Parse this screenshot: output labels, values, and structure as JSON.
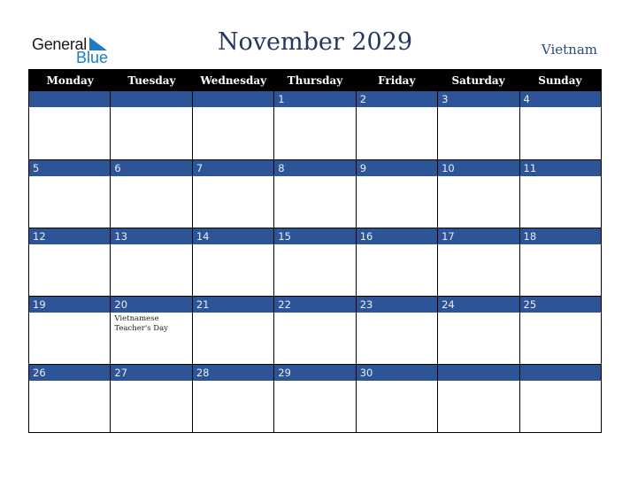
{
  "logo": {
    "word1": "General",
    "word2": "Blue"
  },
  "title": "November 2029",
  "country": "Vietnam",
  "colors": {
    "header_bg": "#000000",
    "date_bar": "#2d5496",
    "title": "#24375f",
    "logo_blue": "#1f7bc1"
  },
  "weekdays": [
    "Monday",
    "Tuesday",
    "Wednesday",
    "Thursday",
    "Friday",
    "Saturday",
    "Sunday"
  ],
  "weeks": [
    {
      "days": [
        {
          "date": "",
          "event": ""
        },
        {
          "date": "",
          "event": ""
        },
        {
          "date": "",
          "event": ""
        },
        {
          "date": "1",
          "event": ""
        },
        {
          "date": "2",
          "event": ""
        },
        {
          "date": "3",
          "event": ""
        },
        {
          "date": "4",
          "event": ""
        }
      ]
    },
    {
      "days": [
        {
          "date": "5",
          "event": ""
        },
        {
          "date": "6",
          "event": ""
        },
        {
          "date": "7",
          "event": ""
        },
        {
          "date": "8",
          "event": ""
        },
        {
          "date": "9",
          "event": ""
        },
        {
          "date": "10",
          "event": ""
        },
        {
          "date": "11",
          "event": ""
        }
      ]
    },
    {
      "days": [
        {
          "date": "12",
          "event": ""
        },
        {
          "date": "13",
          "event": ""
        },
        {
          "date": "14",
          "event": ""
        },
        {
          "date": "15",
          "event": ""
        },
        {
          "date": "16",
          "event": ""
        },
        {
          "date": "17",
          "event": ""
        },
        {
          "date": "18",
          "event": ""
        }
      ]
    },
    {
      "days": [
        {
          "date": "19",
          "event": ""
        },
        {
          "date": "20",
          "event": "Vietnamese Teacher's Day"
        },
        {
          "date": "21",
          "event": ""
        },
        {
          "date": "22",
          "event": ""
        },
        {
          "date": "23",
          "event": ""
        },
        {
          "date": "24",
          "event": ""
        },
        {
          "date": "25",
          "event": ""
        }
      ]
    },
    {
      "days": [
        {
          "date": "26",
          "event": ""
        },
        {
          "date": "27",
          "event": ""
        },
        {
          "date": "28",
          "event": ""
        },
        {
          "date": "29",
          "event": ""
        },
        {
          "date": "30",
          "event": ""
        },
        {
          "date": "",
          "event": ""
        },
        {
          "date": "",
          "event": ""
        }
      ]
    }
  ]
}
